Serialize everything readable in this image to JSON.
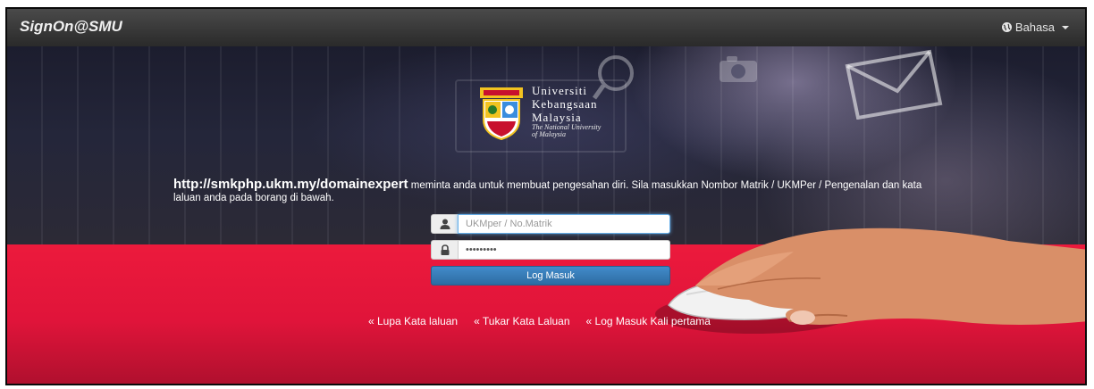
{
  "navbar": {
    "brand": "SignOn@SMU",
    "language_label": "Bahasa"
  },
  "logo": {
    "line1": "Universiti",
    "line2": "Kebangsaan",
    "line3": "Malaysia",
    "tagline1": "The National University",
    "tagline2": "of Malaysia"
  },
  "message": {
    "url": "http://smkphp.ukm.my/domainexpert",
    "text": " meminta anda untuk membuat pengesahan diri. Sila masukkan Nombor Matrik / UKMPer / Pengenalan dan kata laluan anda pada borang di bawah."
  },
  "form": {
    "username_placeholder": "UKMper / No.Matrik",
    "username_value": "",
    "password_value": "•••••••••",
    "login_label": "Log Masuk"
  },
  "links": {
    "forgot": "«  Lupa Kata laluan",
    "change": "«  Tukar Kata Laluan",
    "first": "«  Log Masuk Kali pertama"
  },
  "icons": {
    "user": "user-icon",
    "lock": "lock-icon",
    "globe": "globe-icon"
  }
}
